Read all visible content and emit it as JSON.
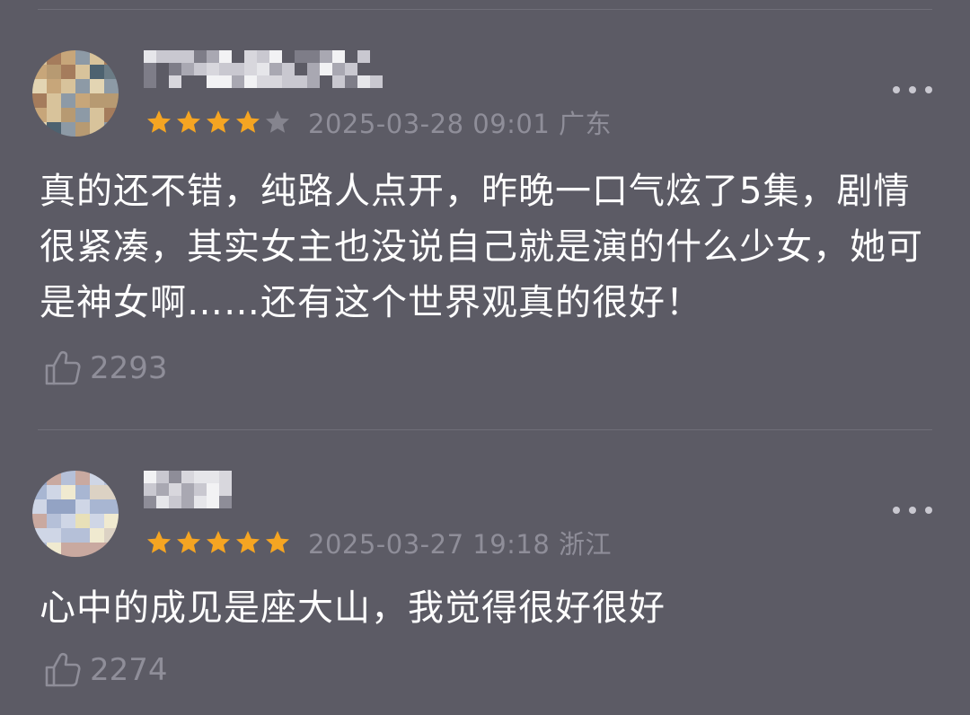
{
  "comments": [
    {
      "rating": 4,
      "max_rating": 5,
      "meta": "2025-03-28 09:01 广东",
      "text": "真的还不错，纯路人点开，昨晚一口气炫了5集，剧情很紧凑，其实女主也没说自己就是演的什么少女，她可是神女啊……还有这个世界观真的很好！",
      "likes": "2293"
    },
    {
      "rating": 5,
      "max_rating": 5,
      "meta": "2025-03-27 19:18 浙江",
      "text": "心中的成见是座大山，我觉得很好很好",
      "likes": "2274"
    }
  ],
  "colors": {
    "background": "#5c5b65",
    "star_filled": "#f5a522",
    "star_empty": "#85848e",
    "meta_text": "#8f8e99"
  },
  "icons": {
    "like": "thumbs-up-icon",
    "more": "more-dots-icon",
    "star": "star-icon"
  }
}
